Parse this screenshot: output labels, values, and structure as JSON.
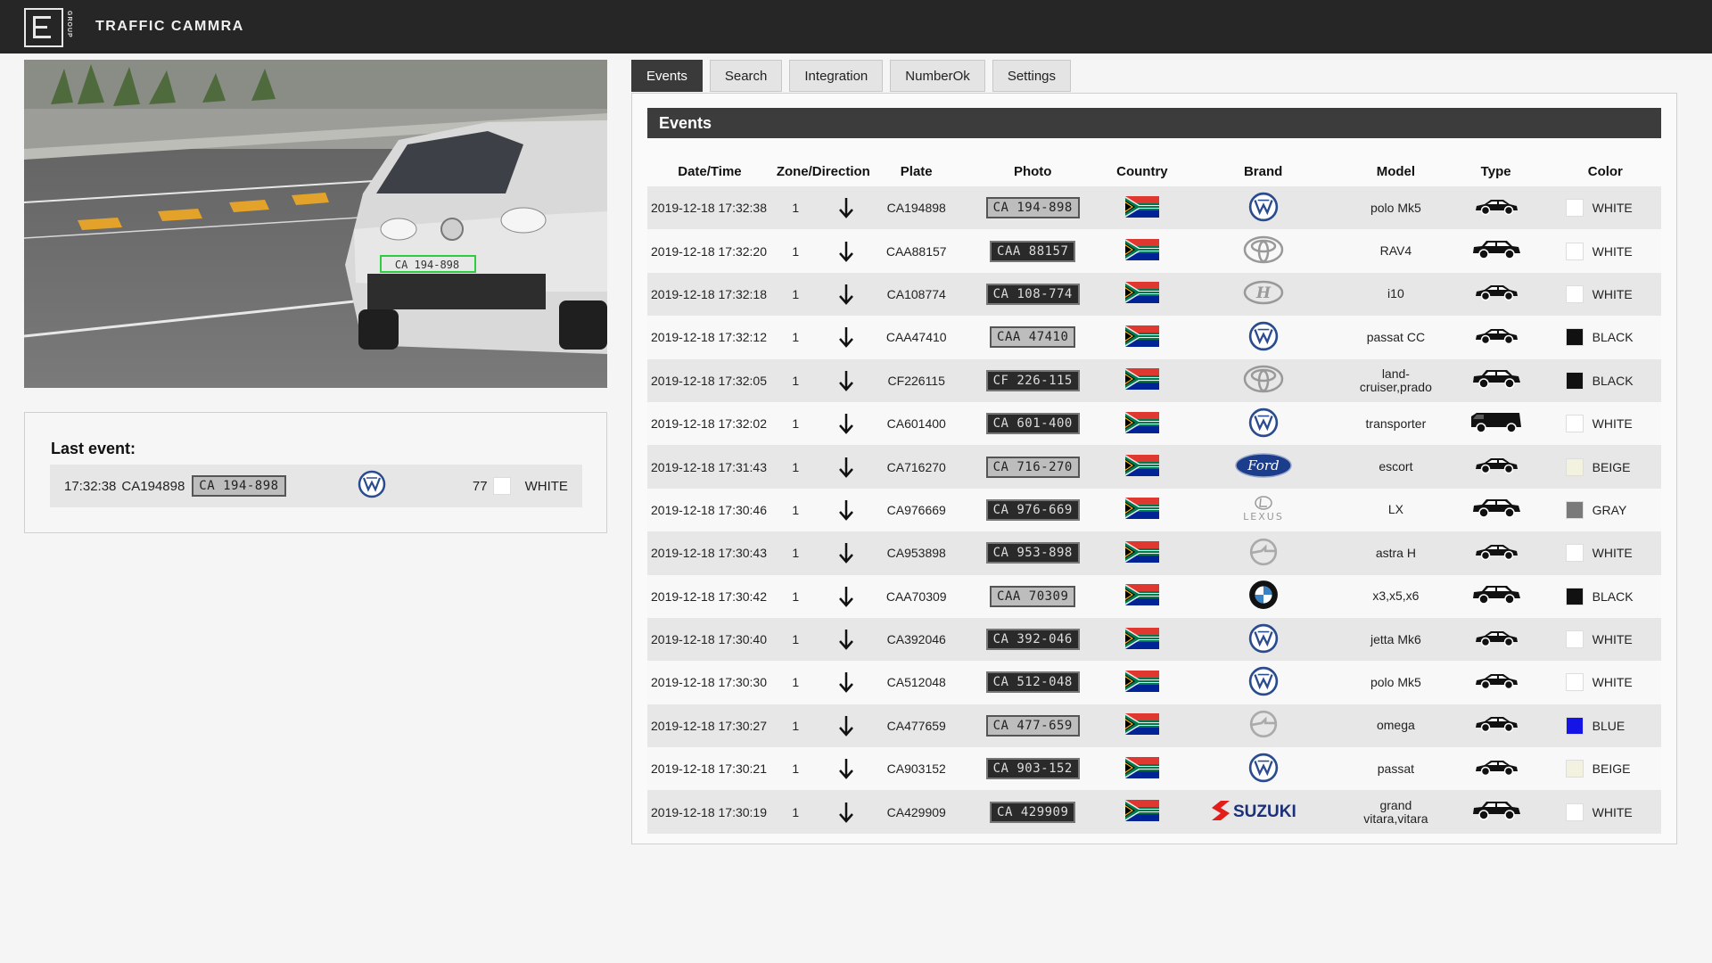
{
  "app": {
    "title": "TRAFFIC CAMMRA",
    "logo_text": "GROUP"
  },
  "tabs": [
    {
      "label": "Events",
      "active": true
    },
    {
      "label": "Search",
      "active": false
    },
    {
      "label": "Integration",
      "active": false
    },
    {
      "label": "NumberOk",
      "active": false
    },
    {
      "label": "Settings",
      "active": false
    }
  ],
  "camera": {
    "plate_overlay": "CA 194-898"
  },
  "last_event": {
    "label": "Last event:",
    "time": "17:32:38",
    "plate": "CA194898",
    "photo_text": "CA 194-898",
    "brand_icon": "vw-logo-icon",
    "speed": "77",
    "color_name": "WHITE",
    "color_hex": "#ffffff"
  },
  "events_panel": {
    "title": "Events",
    "columns": [
      "Date/Time",
      "Zone/Direction",
      "Plate",
      "Photo",
      "Country",
      "Brand",
      "Model",
      "Type",
      "Color"
    ],
    "rows": [
      {
        "datetime": "2019-12-18 17:32:38",
        "zone": "1",
        "plate": "CA194898",
        "photo": "CA 194-898",
        "brand": "vw",
        "model": "polo Mk5",
        "type": "sedan",
        "color": "WHITE",
        "color_hex": "#ffffff"
      },
      {
        "datetime": "2019-12-18 17:32:20",
        "zone": "1",
        "plate": "CAA88157",
        "photo": "CAA 88157",
        "brand": "toyota",
        "model": "RAV4",
        "type": "suv",
        "color": "WHITE",
        "color_hex": "#ffffff"
      },
      {
        "datetime": "2019-12-18 17:32:18",
        "zone": "1",
        "plate": "CA108774",
        "photo": "CA 108-774",
        "brand": "hyundai",
        "model": "i10",
        "type": "sedan",
        "color": "WHITE",
        "color_hex": "#ffffff"
      },
      {
        "datetime": "2019-12-18 17:32:12",
        "zone": "1",
        "plate": "CAA47410",
        "photo": "CAA 47410",
        "brand": "vw",
        "model": "passat CC",
        "type": "sedan",
        "color": "BLACK",
        "color_hex": "#111111"
      },
      {
        "datetime": "2019-12-18 17:32:05",
        "zone": "1",
        "plate": "CF226115",
        "photo": "CF 226-115",
        "brand": "toyota",
        "model": "land-cruiser,prado",
        "type": "suv",
        "color": "BLACK",
        "color_hex": "#111111"
      },
      {
        "datetime": "2019-12-18 17:32:02",
        "zone": "1",
        "plate": "CA601400",
        "photo": "CA 601-400",
        "brand": "vw",
        "model": "transporter",
        "type": "van",
        "color": "WHITE",
        "color_hex": "#ffffff"
      },
      {
        "datetime": "2019-12-18 17:31:43",
        "zone": "1",
        "plate": "CA716270",
        "photo": "CA 716-270",
        "brand": "ford",
        "model": "escort",
        "type": "sedan",
        "color": "BEIGE",
        "color_hex": "#f3f1df"
      },
      {
        "datetime": "2019-12-18 17:30:46",
        "zone": "1",
        "plate": "CA976669",
        "photo": "CA 976-669",
        "brand": "lexus",
        "model": "LX",
        "type": "suv",
        "color": "GRAY",
        "color_hex": "#7a7a7a"
      },
      {
        "datetime": "2019-12-18 17:30:43",
        "zone": "1",
        "plate": "CA953898",
        "photo": "CA 953-898",
        "brand": "opel",
        "model": "astra H",
        "type": "sedan",
        "color": "WHITE",
        "color_hex": "#ffffff"
      },
      {
        "datetime": "2019-12-18 17:30:42",
        "zone": "1",
        "plate": "CAA70309",
        "photo": "CAA 70309",
        "brand": "bmw",
        "model": "x3,x5,x6",
        "type": "suv",
        "color": "BLACK",
        "color_hex": "#111111"
      },
      {
        "datetime": "2019-12-18 17:30:40",
        "zone": "1",
        "plate": "CA392046",
        "photo": "CA 392-046",
        "brand": "vw",
        "model": "jetta Mk6",
        "type": "sedan",
        "color": "WHITE",
        "color_hex": "#ffffff"
      },
      {
        "datetime": "2019-12-18 17:30:30",
        "zone": "1",
        "plate": "CA512048",
        "photo": "CA 512-048",
        "brand": "vw",
        "model": "polo Mk5",
        "type": "sedan",
        "color": "WHITE",
        "color_hex": "#ffffff"
      },
      {
        "datetime": "2019-12-18 17:30:27",
        "zone": "1",
        "plate": "CA477659",
        "photo": "CA 477-659",
        "brand": "opel",
        "model": "omega",
        "type": "sedan",
        "color": "BLUE",
        "color_hex": "#1414e6"
      },
      {
        "datetime": "2019-12-18 17:30:21",
        "zone": "1",
        "plate": "CA903152",
        "photo": "CA 903-152",
        "brand": "vw",
        "model": "passat",
        "type": "sedan",
        "color": "BEIGE",
        "color_hex": "#f3f1df"
      },
      {
        "datetime": "2019-12-18 17:30:19",
        "zone": "1",
        "plate": "CA429909",
        "photo": "CA 429909",
        "brand": "suzuki",
        "model": "grand vitara,vitara",
        "type": "suv",
        "color": "WHITE",
        "color_hex": "#ffffff"
      }
    ]
  },
  "brand_text": {
    "suzuki": "SUZUKI",
    "ford": "Ford",
    "lexus": "LEXUS"
  }
}
